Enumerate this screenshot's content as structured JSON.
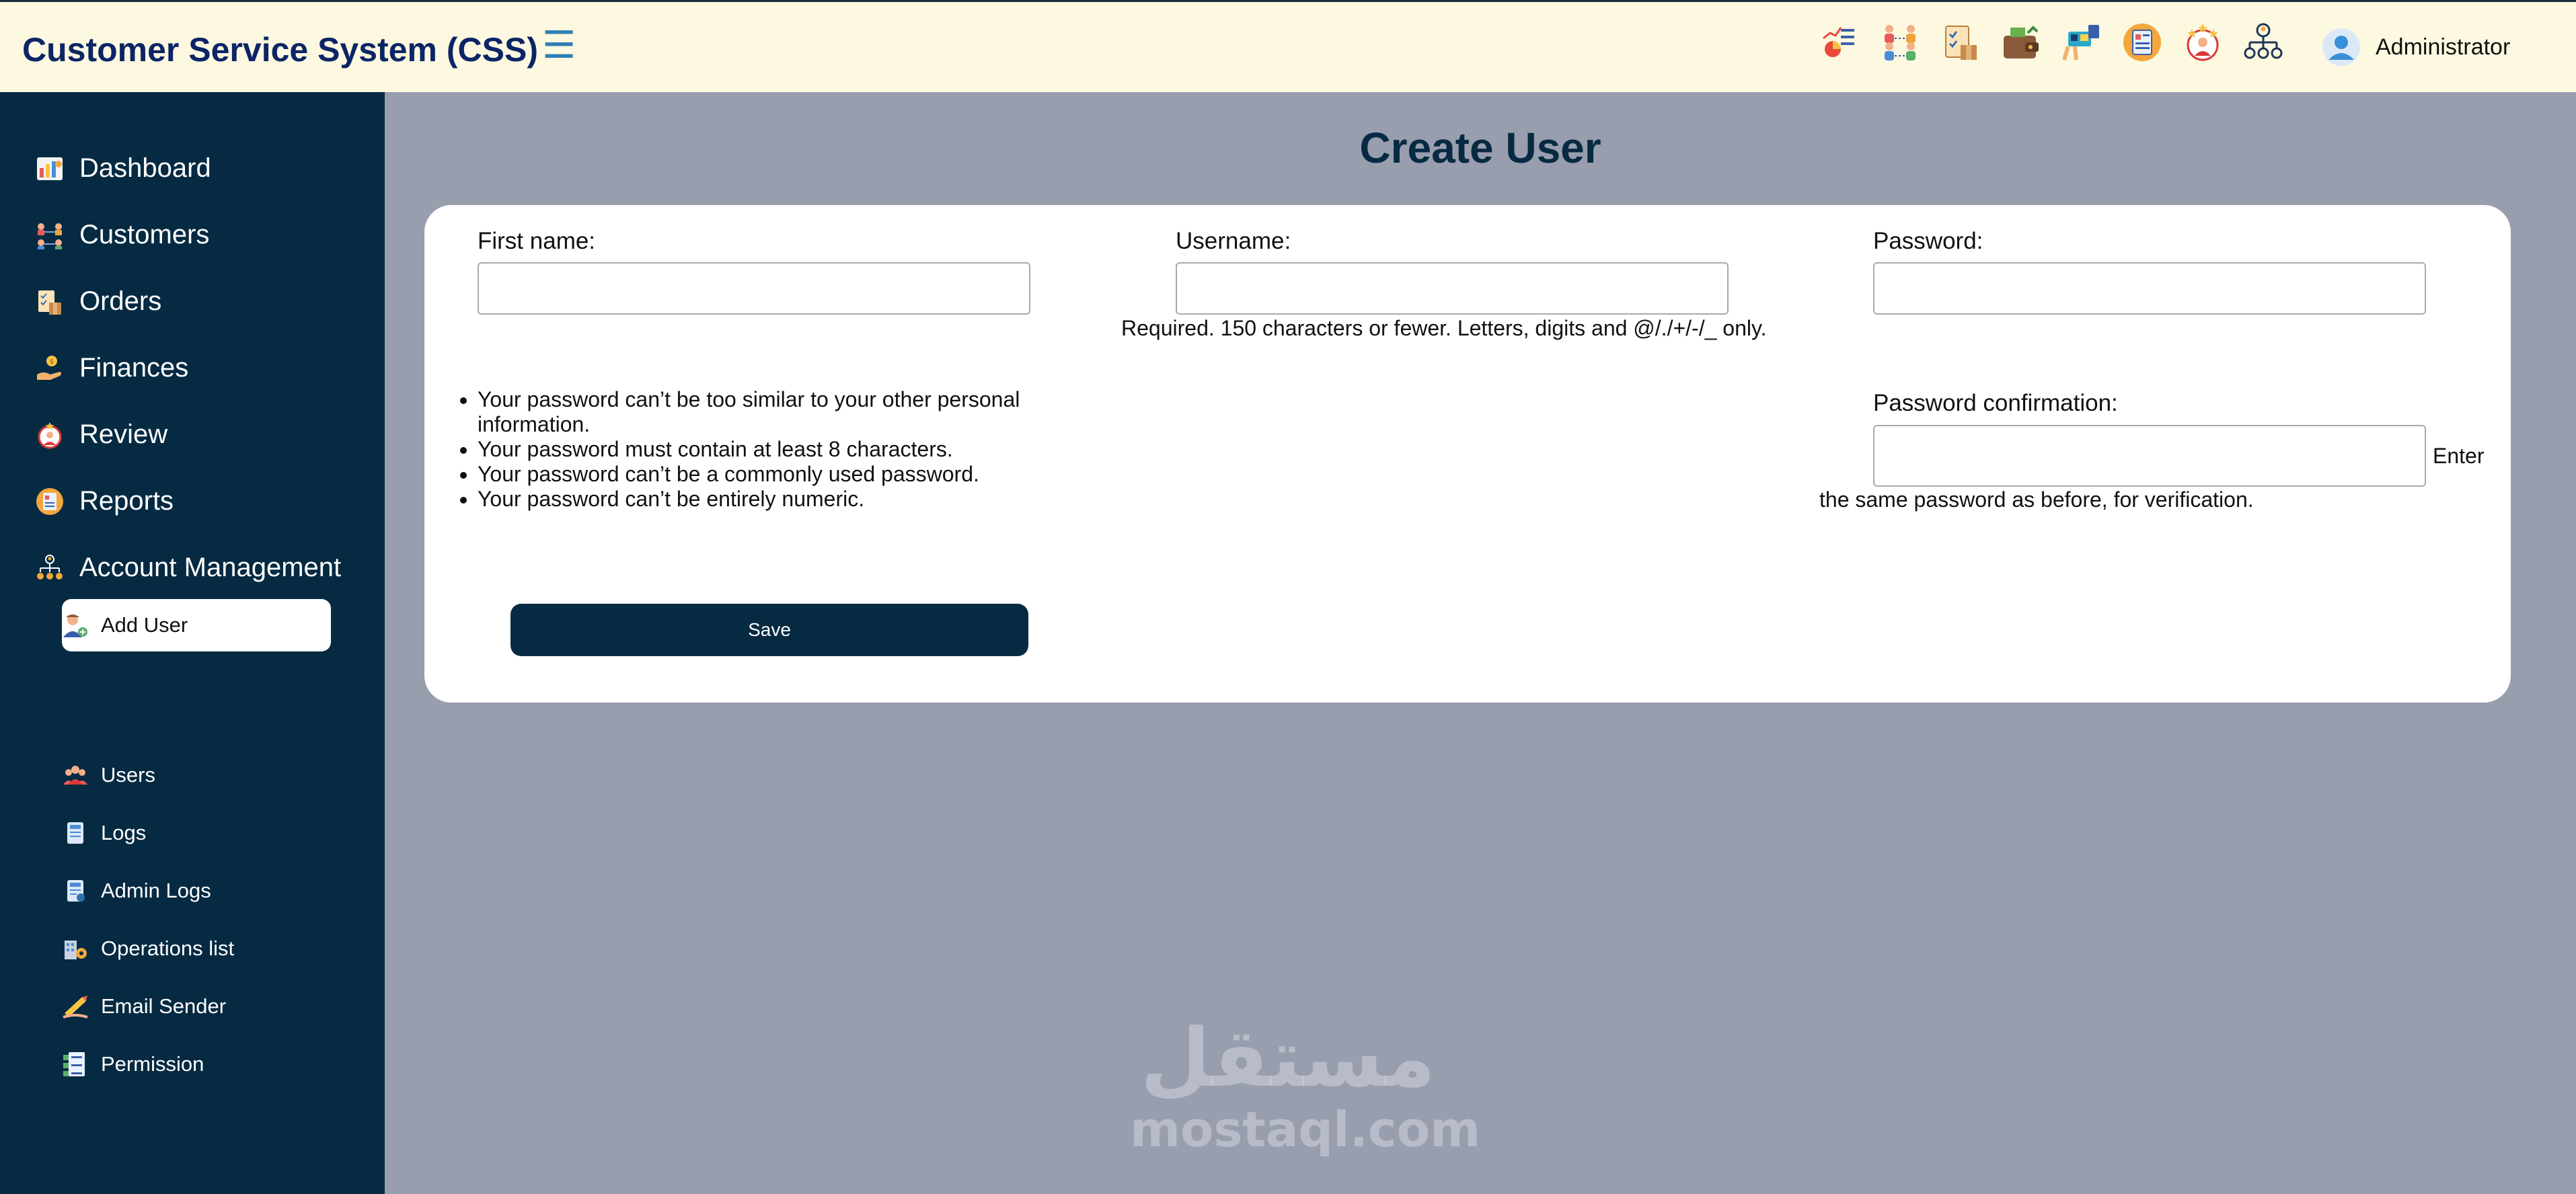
{
  "header": {
    "title": "Customer Service System (CSS)",
    "menu_icon": "☰",
    "icons": [
      "dashboard-icon",
      "customers-icon",
      "orders-icon",
      "finances-icon",
      "shop-icon",
      "reports-icon",
      "review-icon",
      "account-management-icon"
    ],
    "user_name": "Administrator"
  },
  "sidebar": {
    "items": [
      {
        "label": "Dashboard",
        "icon": "dashboard-icon"
      },
      {
        "label": "Customers",
        "icon": "customers-icon"
      },
      {
        "label": "Orders",
        "icon": "orders-icon"
      },
      {
        "label": "Finances",
        "icon": "finances-icon"
      },
      {
        "label": "Review",
        "icon": "review-icon"
      },
      {
        "label": "Reports",
        "icon": "reports-icon"
      },
      {
        "label": "Account Management",
        "icon": "account-management-icon"
      }
    ],
    "sub_items": [
      {
        "label": "Add User",
        "icon": "add-user-icon",
        "active": true
      },
      {
        "label": "Users",
        "icon": "users-icon"
      },
      {
        "label": "Logs",
        "icon": "logs-icon"
      },
      {
        "label": "Admin Logs",
        "icon": "admin-logs-icon"
      },
      {
        "label": "Operations list",
        "icon": "operations-list-icon"
      },
      {
        "label": "Email Sender",
        "icon": "email-sender-icon"
      },
      {
        "label": "Permission",
        "icon": "permission-icon"
      }
    ]
  },
  "main": {
    "title": "Create User",
    "form": {
      "first_name_label": "First name:",
      "first_name_value": "",
      "username_label": "Username:",
      "username_value": "",
      "username_help": "Required. 150 characters or fewer. Letters, digits and @/./+/-/_ only.",
      "password_label": "Password:",
      "password_value": "",
      "password_rules": [
        "Your password can’t be too similar to your other personal information.",
        "Your password must contain at least 8 characters.",
        "Your password can’t be a commonly used password.",
        "Your password can’t be entirely numeric."
      ],
      "password_confirmation_label": "Password confirmation:",
      "password_confirmation_value": "",
      "password_confirmation_help_1": "Enter",
      "password_confirmation_help_2": "the same password as before, for verification.",
      "save_label": "Save"
    }
  },
  "watermark": {
    "logo_text": "مستقل",
    "site": "mostaql.com"
  },
  "colors": {
    "header_bg": "#fdf8e0",
    "sidebar_bg": "#062a42",
    "page_bg": "#989eae",
    "title_color": "#062a42",
    "brand_color": "#0b2566"
  }
}
